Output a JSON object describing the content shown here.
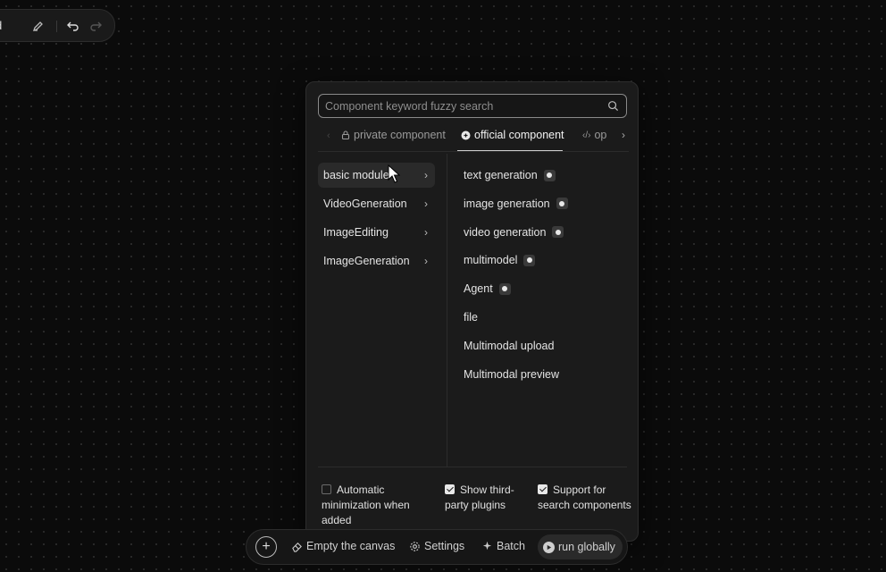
{
  "top_toolbar": {
    "label": "d",
    "icons": [
      "pencil-icon",
      "undo-icon",
      "redo-icon"
    ]
  },
  "panel": {
    "search": {
      "placeholder": "Component keyword fuzzy search",
      "value": ""
    },
    "tabs": [
      {
        "label": "private component",
        "icon": "lock-icon",
        "active": false
      },
      {
        "label": "official component",
        "icon": "official-icon",
        "active": true
      },
      {
        "label": "op",
        "icon": "code-icon",
        "active": false
      }
    ],
    "categories": [
      {
        "label": "basic module",
        "active": true
      },
      {
        "label": "VideoGeneration",
        "active": false
      },
      {
        "label": "ImageEditing",
        "active": false
      },
      {
        "label": "ImageGeneration",
        "active": false
      }
    ],
    "components": [
      {
        "label": "text generation",
        "badge": true
      },
      {
        "label": "image generation",
        "badge": true
      },
      {
        "label": "video generation",
        "badge": true
      },
      {
        "label": "multimodel",
        "badge": true
      },
      {
        "label": "Agent",
        "badge": true
      },
      {
        "label": "file",
        "badge": false
      },
      {
        "label": "Multimodal upload",
        "badge": false
      },
      {
        "label": "Multimodal preview",
        "badge": false
      }
    ],
    "options": {
      "auto_minimize": {
        "label": "Automatic minimization when added",
        "checked": false
      },
      "third_party": {
        "label": "Show third-party plugins",
        "checked": true
      },
      "search_components": {
        "label": "Support for search components",
        "checked": true
      }
    }
  },
  "bottom_toolbar": {
    "empty_label": "Empty the canvas",
    "settings_label": "Settings",
    "batch_label": "Batch",
    "run_label": "run globally"
  },
  "colors": {
    "background": "#0b0b0b",
    "panel": "#1b1b1b",
    "active_item": "#2a2a2a",
    "text": "#e4e4e4"
  }
}
